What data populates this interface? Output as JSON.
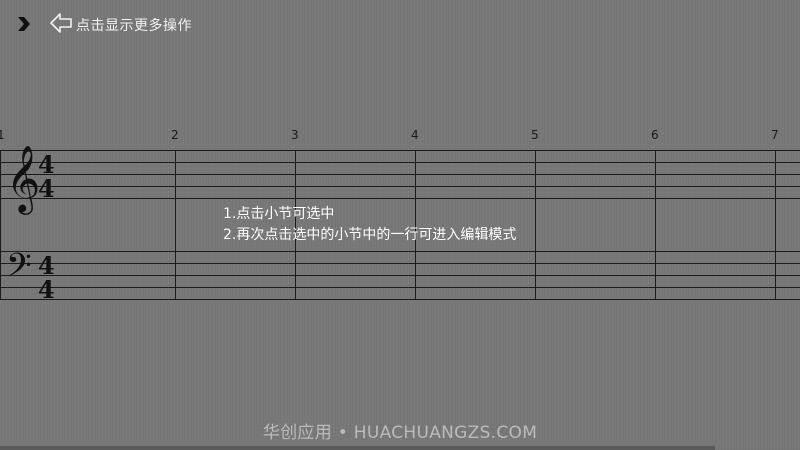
{
  "toolbar": {
    "menu_icon": "chevron-right-icon",
    "back_icon": "arrow-left-outline-icon",
    "more_label": "点击显示更多操作"
  },
  "score": {
    "measure_numbers": [
      "1",
      "2",
      "3",
      "4",
      "5",
      "6",
      "7"
    ],
    "treble_clef": "𝄞",
    "bass_clef": "𝄢",
    "time_signature": {
      "top": "4",
      "bottom": "4"
    }
  },
  "instructions": {
    "line1": "1.点击小节可选中",
    "line2": "2.再次点击选中的小节中的一行可进入编辑模式"
  },
  "watermark": "华创应用 • HUACHUANGZS.COM"
}
